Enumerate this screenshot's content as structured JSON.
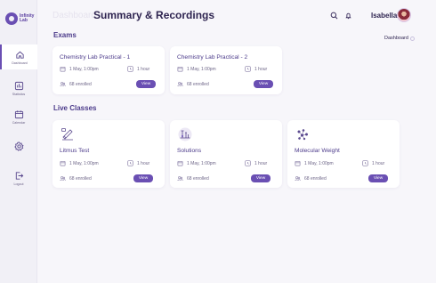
{
  "brand": {
    "name": "Infinity Lab"
  },
  "sidebar": {
    "items": [
      {
        "label": "Dashboard",
        "icon": "home-icon",
        "active": true
      },
      {
        "label": "Statistics",
        "icon": "chart-icon",
        "active": false
      },
      {
        "label": "Calendar",
        "icon": "calendar-icon",
        "active": false
      },
      {
        "label": "",
        "icon": "gear-icon",
        "active": false
      },
      {
        "label": "Logout",
        "icon": "logout-icon",
        "active": false
      }
    ]
  },
  "header": {
    "breadcrumb": "Dashboard",
    "title": "Summary & Recordings",
    "user_name": "Isabella"
  },
  "exams": {
    "section_title": "Exams",
    "dashboard_link": "Dashboard",
    "cards": [
      {
        "title": "Chemistry Lab Practical - 1",
        "date": "1 May, 1:00pm",
        "duration": "1 hour",
        "enrolled": "68 enrolled",
        "button": "View"
      },
      {
        "title": "Chemistry Lab Practical - 2",
        "date": "1 May, 1:00pm",
        "duration": "1 hour",
        "enrolled": "68 enrolled",
        "button": "View"
      }
    ]
  },
  "live_classes": {
    "section_title": "Live Classes",
    "cards": [
      {
        "title": "Litmus Test",
        "date": "1 May, 1:00pm",
        "duration": "1 hour",
        "enrolled": "68 enrolled",
        "button": "View",
        "icon": "litmus-test-icon"
      },
      {
        "title": "Solutions",
        "date": "1 May, 1:00pm",
        "duration": "1 hour",
        "enrolled": "68 enrolled",
        "button": "View",
        "icon": "flask-icon"
      },
      {
        "title": "Molecular Weight",
        "date": "1 May, 1:00pm",
        "duration": "1 hour",
        "enrolled": "68 enrolled",
        "button": "View",
        "icon": "molecule-icon"
      }
    ]
  },
  "colors": {
    "accent": "#6a4fb3",
    "background": "#f7f6fa",
    "sidebar": "#f1f0f6"
  }
}
